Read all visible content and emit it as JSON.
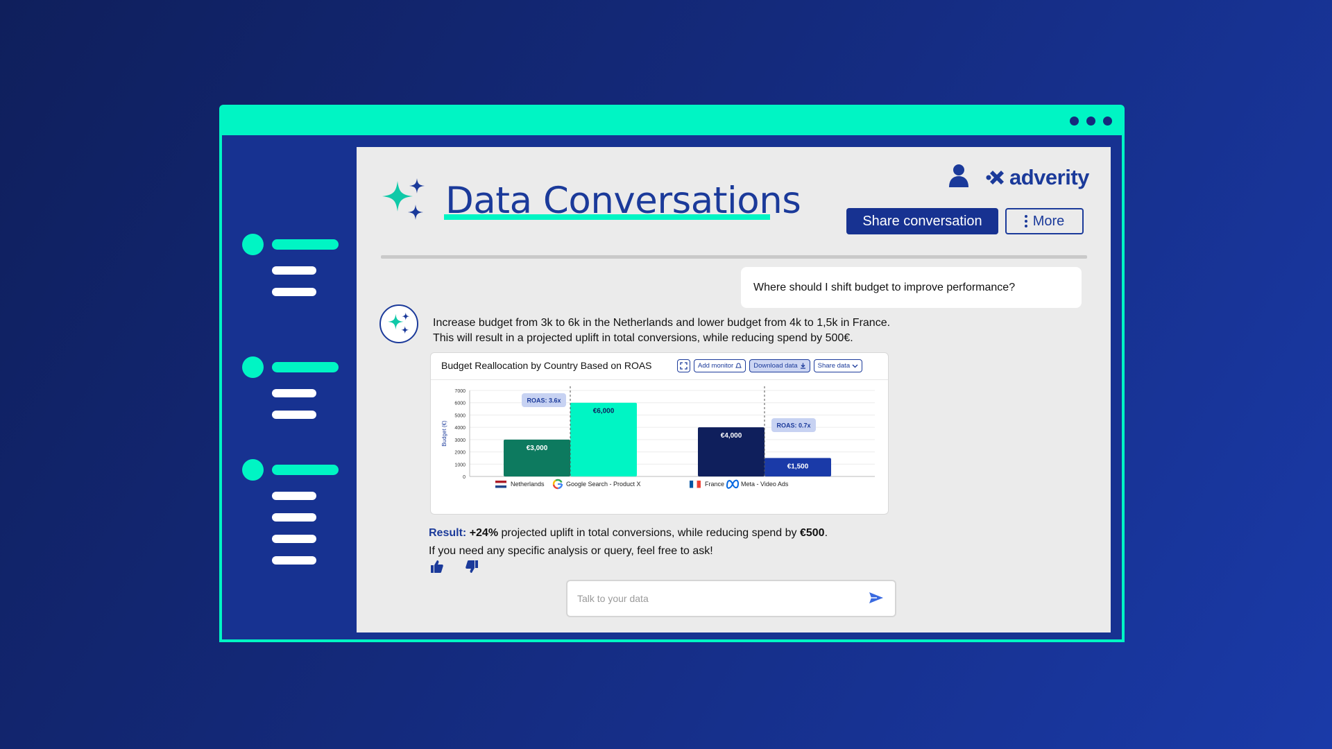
{
  "app": {
    "title": "Data Conversations",
    "brand": "adverity",
    "share_label": "Share conversation",
    "more_label": "More"
  },
  "sidebar": {
    "groups": [
      {
        "sub_items": 2
      },
      {
        "sub_items": 2
      },
      {
        "sub_items": 4
      }
    ]
  },
  "conversation": {
    "user_message": "Where should I shift budget to improve performance?",
    "bot_lines": [
      "Increase budget from 3k to 6k in the Netherlands and lower budget from 4k to 1,5k in France.",
      "This will result in a projected uplift in total conversions, while reducing spend by 500€."
    ],
    "result_label": "Result:",
    "result_value": "+24%",
    "result_mid": " projected uplift in total conversions, while reducing spend by ",
    "result_amount": "€500",
    "result_end": ".",
    "follow_up": "If you need any specific analysis or query, feel free to ask!"
  },
  "chart_card": {
    "title": "Budget Reallocation by Country Based on ROAS",
    "add_monitor": "Add monitor",
    "download_data": "Download data",
    "share_data": "Share data"
  },
  "chart_data": {
    "type": "bar",
    "title": "Budget Reallocation by Country Based on ROAS",
    "ylabel": "Budget (€)",
    "xlabel": "",
    "ylim": [
      0,
      7000
    ],
    "yticks": [
      0,
      1000,
      2000,
      3000,
      4000,
      5000,
      6000,
      7000
    ],
    "grid": true,
    "groups": [
      {
        "country": "Netherlands",
        "channel": "Google Search - Product X",
        "roas": "ROAS: 3.6x",
        "bars": [
          {
            "value": 3000,
            "label": "€3,000",
            "color": "#0d7a5f"
          },
          {
            "value": 6000,
            "label": "€6,000",
            "color": "#00f5c4"
          }
        ]
      },
      {
        "country": "France",
        "channel": "Meta - Video Ads",
        "roas": "ROAS: 0.7x",
        "bars": [
          {
            "value": 4000,
            "label": "€4,000",
            "color": "#0f1f5c"
          },
          {
            "value": 1500,
            "label": "€1,500",
            "color": "#1a3aa8"
          }
        ]
      }
    ]
  },
  "input": {
    "placeholder": "Talk to your data"
  },
  "colors": {
    "accent": "#00f5c4",
    "primary": "#1b3a9a",
    "sidebar": "#173291"
  }
}
